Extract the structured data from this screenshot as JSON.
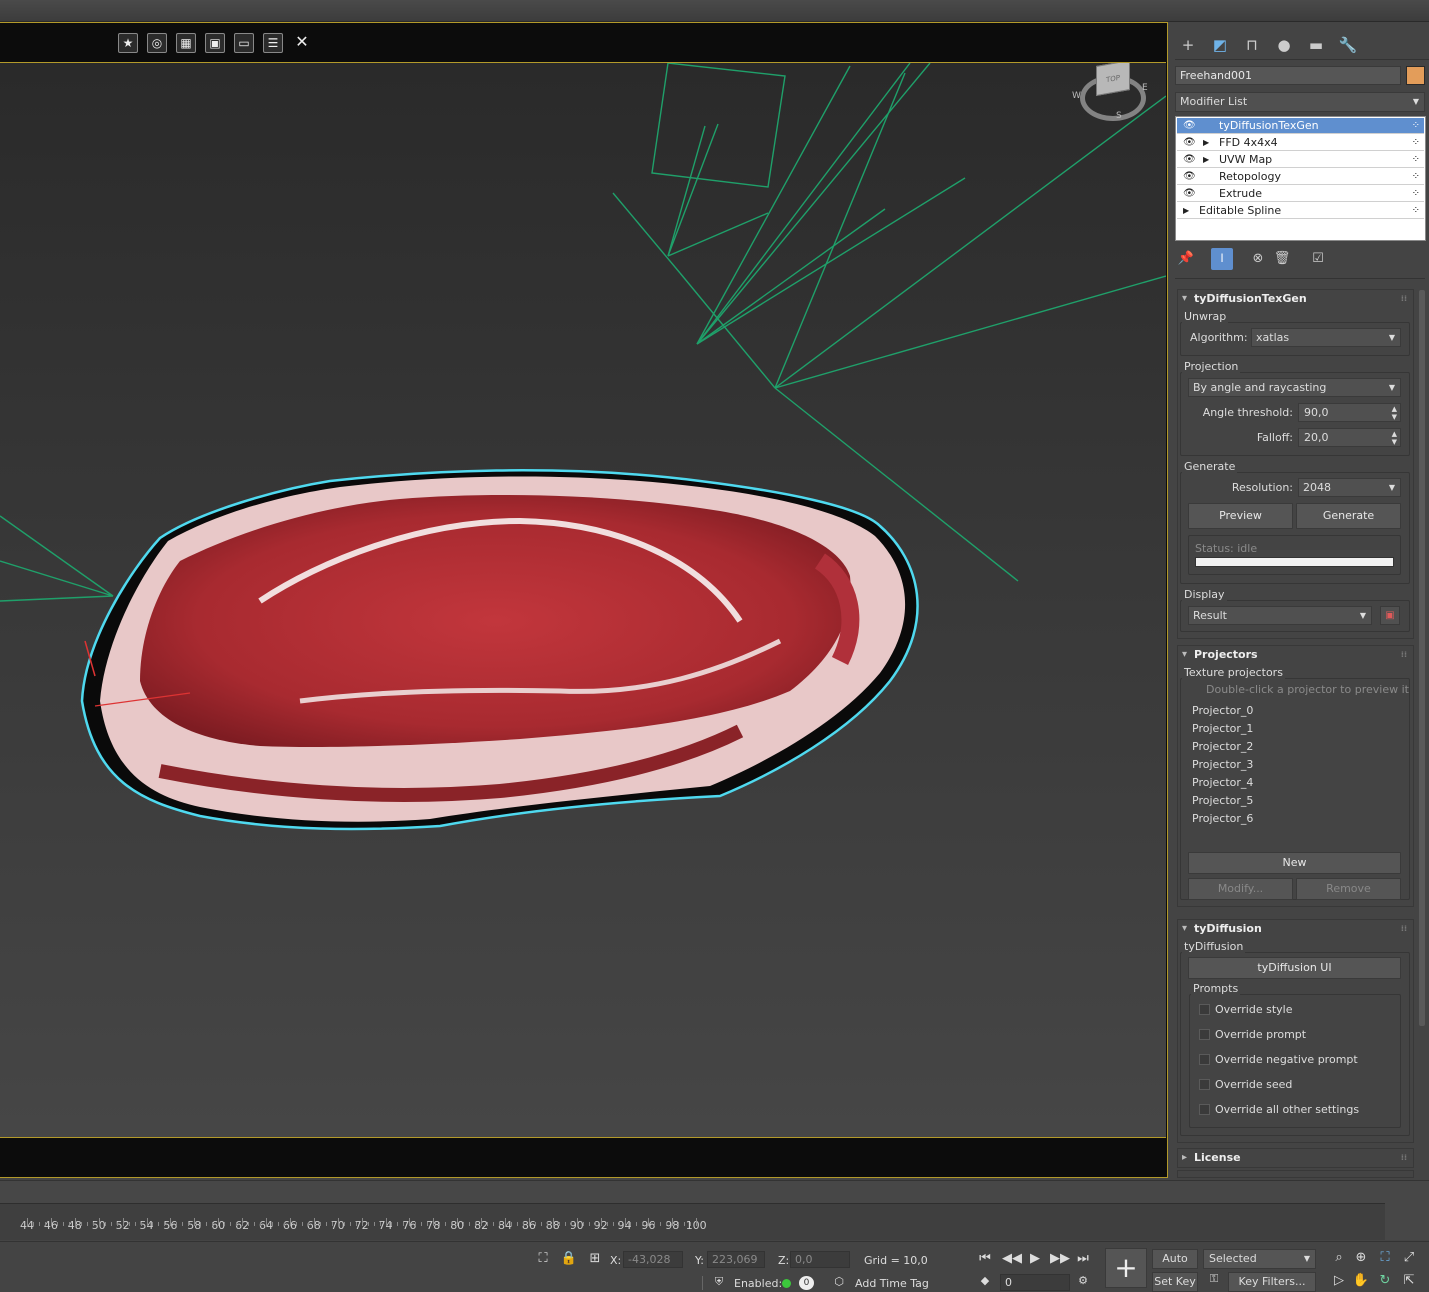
{
  "viewport": {
    "toolbar_icons": [
      "star-icon",
      "camera-icon",
      "clapper-icon",
      "save-icon",
      "monitor-icon",
      "settings-icon",
      "close-icon"
    ],
    "navcube": {
      "labels": [
        "W",
        "E",
        "S"
      ],
      "face": "TOP"
    }
  },
  "command_panel": {
    "tabs": [
      "create-icon",
      "modify-icon",
      "hierarchy-icon",
      "motion-icon",
      "display-icon",
      "utilities-icon"
    ],
    "object_name": "Freehand001",
    "object_color": "#e39d5a",
    "modifier_list_label": "Modifier List",
    "stack": [
      {
        "label": "tyDiffusionTexGen",
        "selected": true,
        "expandable": false,
        "eye": true
      },
      {
        "label": "FFD 4x4x4",
        "selected": false,
        "expandable": true,
        "eye": true
      },
      {
        "label": "UVW Map",
        "selected": false,
        "expandable": true,
        "eye": true
      },
      {
        "label": "Retopology",
        "selected": false,
        "expandable": false,
        "eye": true
      },
      {
        "label": "Extrude",
        "selected": false,
        "expandable": false,
        "eye": true
      },
      {
        "label": "Editable Spline",
        "selected": false,
        "expandable": true,
        "eye": false
      }
    ]
  },
  "texgen": {
    "title": "tyDiffusionTexGen",
    "unwrap_group": "Unwrap",
    "algorithm_label": "Algorithm:",
    "algorithm_value": "xatlas",
    "projection_group": "Projection",
    "projection_mode": "By angle and raycasting",
    "angle_label": "Angle threshold:",
    "angle_value": "90,0",
    "falloff_label": "Falloff:",
    "falloff_value": "20,0",
    "generate_group": "Generate",
    "resolution_label": "Resolution:",
    "resolution_value": "2048",
    "preview_btn": "Preview",
    "generate_btn": "Generate",
    "status_text": "Status: idle",
    "display_group": "Display",
    "display_value": "Result"
  },
  "projectors": {
    "title": "Projectors",
    "group": "Texture projectors",
    "hint": "Double-click a projector to preview it",
    "items": [
      "Projector_0",
      "Projector_1",
      "Projector_2",
      "Projector_3",
      "Projector_4",
      "Projector_5",
      "Projector_6"
    ],
    "new_btn": "New",
    "modify_btn": "Modify...",
    "remove_btn": "Remove"
  },
  "tydiffusion": {
    "title": "tyDiffusion",
    "group": "tyDiffusion",
    "ui_btn": "tyDiffusion UI",
    "prompts_group": "Prompts",
    "options": [
      "Override style",
      "Override prompt",
      "Override negative prompt",
      "Override seed",
      "Override all other settings"
    ]
  },
  "license": {
    "title": "License"
  },
  "timeline": {
    "ticks": [
      "44",
      "46",
      "48",
      "50",
      "52",
      "54",
      "56",
      "58",
      "60",
      "62",
      "64",
      "66",
      "68",
      "70",
      "72",
      "74",
      "76",
      "78",
      "80",
      "82",
      "84",
      "86",
      "88",
      "90",
      "92",
      "94",
      "96",
      "98",
      "100"
    ]
  },
  "status": {
    "x_label": "X:",
    "x_value": "-43,028",
    "y_label": "Y:",
    "y_value": "223,069",
    "z_label": "Z:",
    "z_value": "0,0",
    "grid": "Grid = 10,0",
    "enabled": "Enabled:",
    "enabled_count": "0",
    "add_time_tag": "Add Time Tag",
    "frame_value": "0",
    "auto_key": "Auto Key",
    "set_key": "Set Key",
    "selected": "Selected",
    "key_filters": "Key Filters..."
  }
}
